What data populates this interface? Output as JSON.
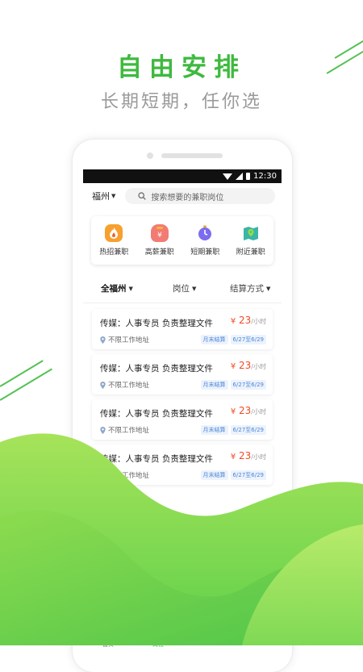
{
  "promo": {
    "headline": "自由安排",
    "subline": "长期短期，任你选"
  },
  "status_bar": {
    "time": "12:30"
  },
  "search": {
    "city": "福州",
    "placeholder": "搜索想要的兼职岗位"
  },
  "categories": [
    {
      "label": "热招兼职",
      "icon": "flame-icon"
    },
    {
      "label": "高薪兼职",
      "icon": "money-bag-icon"
    },
    {
      "label": "短期兼职",
      "icon": "stopwatch-icon"
    },
    {
      "label": "附近兼职",
      "icon": "map-pin-icon"
    }
  ],
  "filters": [
    {
      "label": "全福州"
    },
    {
      "label": "岗位"
    },
    {
      "label": "结算方式"
    }
  ],
  "jobs": [
    {
      "title": "传媒：人事专员 负责整理文件",
      "currency": "¥",
      "price": "23",
      "unit": "/小时",
      "location": "不限工作地址",
      "settlement": "月末结算",
      "dates": "6/27至6/29"
    },
    {
      "title": "传媒：人事专员 负责整理文件",
      "currency": "¥",
      "price": "23",
      "unit": "/小时",
      "location": "不限工作地址",
      "settlement": "月末结算",
      "dates": "6/27至6/29"
    },
    {
      "title": "传媒：人事专员 负责整理文件",
      "currency": "¥",
      "price": "23",
      "unit": "/小时",
      "location": "不限工作地址",
      "settlement": "月末结算",
      "dates": "6/27至6/29"
    },
    {
      "title": "传媒：人事专员 负责整理文件",
      "currency": "¥",
      "price": "23",
      "unit": "/小时",
      "location": "不限工作地址",
      "settlement": "月末结算",
      "dates": "6/27至6/29"
    }
  ],
  "tabbar": [
    {
      "label": "首页",
      "icon": "home-icon",
      "active": false
    },
    {
      "label": "岗位",
      "icon": "briefcase-icon",
      "active": true
    }
  ],
  "colors": {
    "brand_green": "#3fb93f",
    "price_red": "#f04a26",
    "tag_blue": "#4a86d9"
  }
}
